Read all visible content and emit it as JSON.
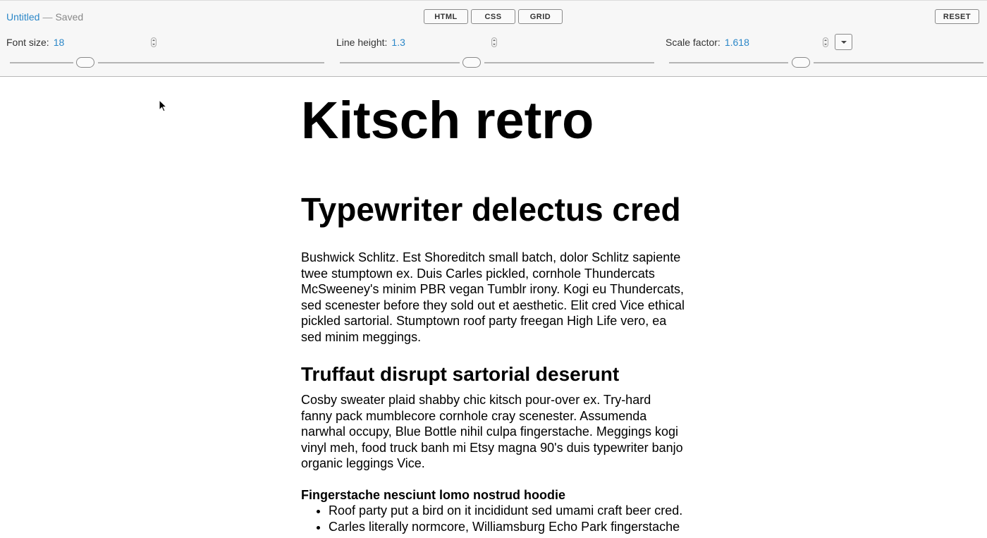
{
  "document": {
    "title": "Untitled",
    "separator": "—",
    "status": "Saved"
  },
  "toolbar": {
    "modes": [
      "HTML",
      "CSS",
      "GRID"
    ],
    "reset_label": "RESET",
    "font_size": {
      "label": "Font size:",
      "value": "18"
    },
    "line_height": {
      "label": "Line height:",
      "value": "1.3"
    },
    "scale_factor": {
      "label": "Scale factor:",
      "value": "1.618"
    }
  },
  "article": {
    "h1": "Kitsch retro",
    "h2": "Typewriter delectus cred",
    "p1": "Bushwick Schlitz. Est Shoreditch small batch, dolor Schlitz sapiente twee stumptown ex. Duis Carles pickled, cornhole Thundercats McSweeney's minim PBR vegan Tumblr irony. Kogi eu Thundercats, sed scenester before they sold out et aesthetic. Elit cred Vice ethical pickled sartorial. Stumptown roof party freegan High Life vero, ea sed minim meggings.",
    "h3": "Truffaut disrupt sartorial deserunt",
    "p2": "Cosby sweater plaid shabby chic kitsch pour-over ex. Try-hard fanny pack mumblecore cornhole cray scenester. Assumenda narwhal occupy, Blue Bottle nihil culpa fingerstache. Meggings kogi vinyl meh, food truck banh mi Etsy magna 90's duis typewriter banjo organic leggings Vice.",
    "h4": "Fingerstache nesciunt lomo nostrud hoodie",
    "list": [
      "Roof party put a bird on it incididunt sed umami craft beer cred.",
      "Carles literally normcore, Williamsburg Echo Park fingerstache"
    ]
  },
  "colors": {
    "accent": "#2b87c8",
    "toolbar_bg": "#f7f7f7",
    "text": "#000000"
  },
  "icons": {
    "dropdown": "chevron-down-icon",
    "cursor": "mouse-pointer-icon"
  }
}
